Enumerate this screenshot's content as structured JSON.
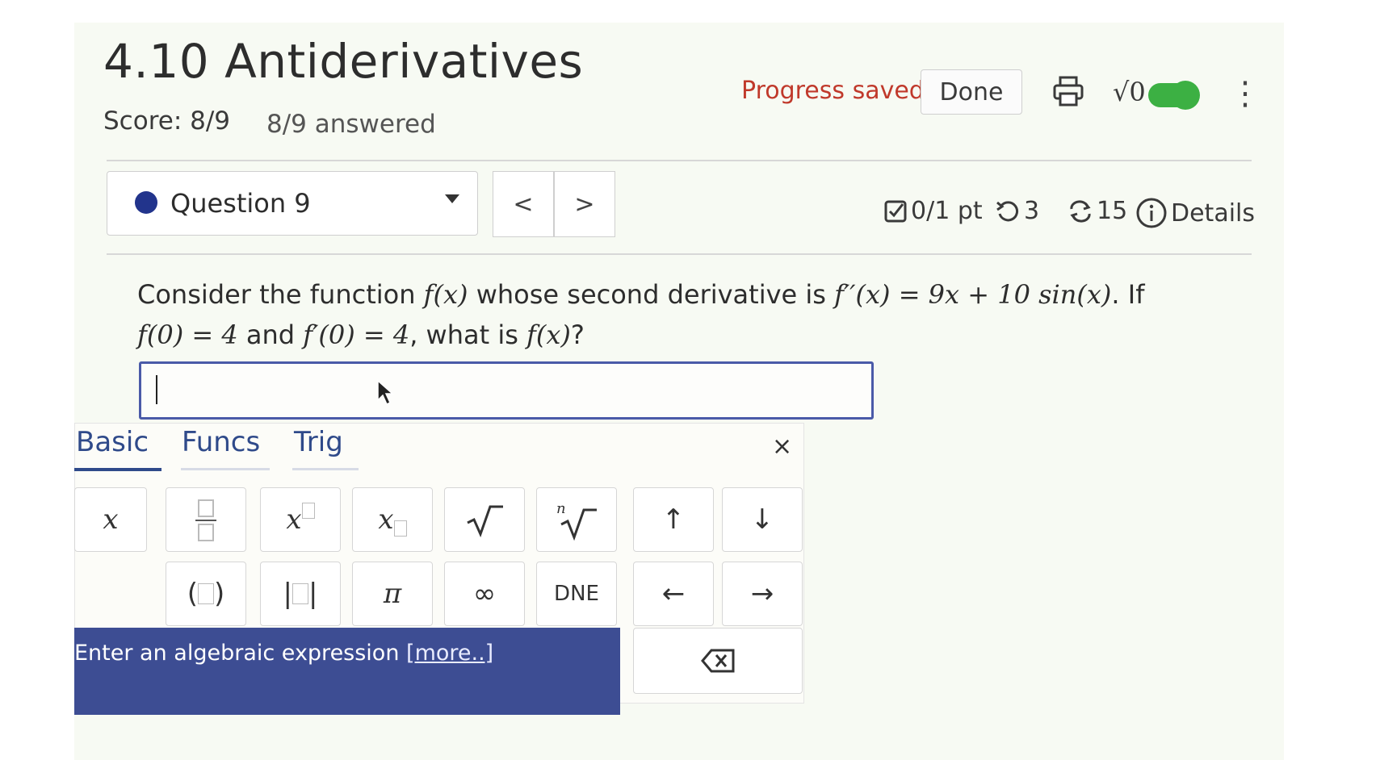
{
  "header": {
    "title": "4.10 Antiderivatives",
    "score": "Score: 8/9",
    "answered": "8/9 answered",
    "progress_status": "Progress saved",
    "done_label": "Done",
    "math_toggle_label": "√0",
    "print_icon": "printer-icon",
    "menu_icon": "kebab-menu-icon",
    "status_color": "#c0392b",
    "toggle_color": "#3cb043"
  },
  "question_nav": {
    "selected": "Question 9",
    "prev_label": "<",
    "next_label": ">",
    "points": "0/1 pt",
    "attempts": "3",
    "versions": "15",
    "details_label": "Details",
    "dot_color": "#22348c"
  },
  "question": {
    "part1": "Consider the function ",
    "fx": "f(x)",
    "part2": " whose second derivative is ",
    "fpp": "f′′(x) = 9x + 10 sin(x)",
    "part3": ". If ",
    "cond1": "f(0) = 4",
    "and": " and ",
    "cond2": "f′(0) = 4",
    "part4": ", what is ",
    "fx2": "f(x)",
    "part5": "?",
    "answer_value": ""
  },
  "keypad": {
    "tabs": [
      "Basic",
      "Funcs",
      "Trig"
    ],
    "active_tab": "Basic",
    "close_label": "×",
    "keys_row1": [
      "x",
      "fraction",
      "x^□",
      "x_□",
      "√",
      "ⁿ√",
      "↑",
      "↓"
    ],
    "keys_row2": [
      "(□)",
      "|□|",
      "π",
      "∞",
      "DNE",
      "←",
      "→"
    ],
    "backspace_label": "⌫",
    "hint_text": "Enter an algebraic expression ",
    "hint_link": "[more..]",
    "accent": "#3d4d93"
  }
}
